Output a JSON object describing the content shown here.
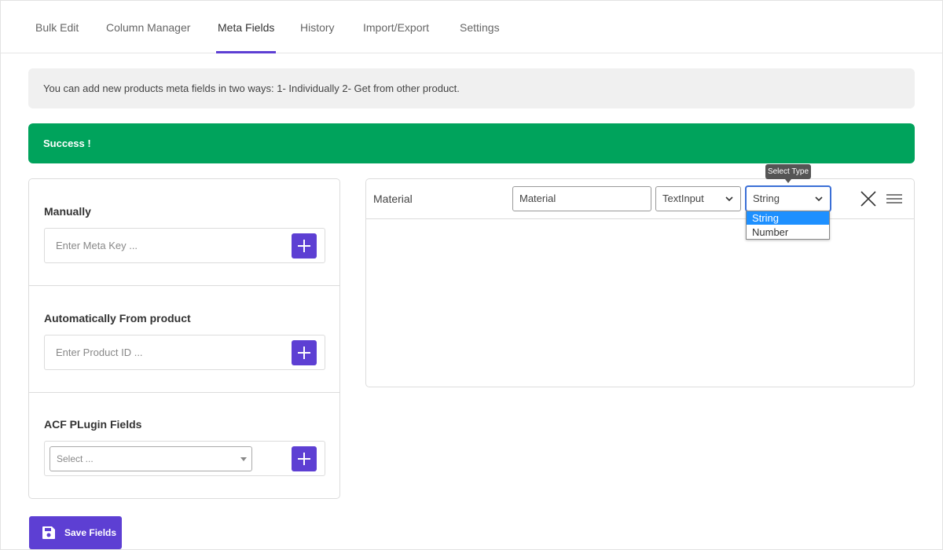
{
  "tabs": [
    {
      "label": "Bulk Edit"
    },
    {
      "label": "Column Manager"
    },
    {
      "label": "Meta Fields",
      "active": true
    },
    {
      "label": "History"
    },
    {
      "label": "Import/Export"
    },
    {
      "label": "Settings"
    }
  ],
  "notice": "You can add new products meta fields in two ways: 1- Individually 2- Get from other product.",
  "success": "Success !",
  "left": {
    "manually": {
      "title": "Manually",
      "placeholder": "Enter Meta Key ..."
    },
    "automatic": {
      "title": "Automatically From product",
      "placeholder": "Enter Product ID ..."
    },
    "acf": {
      "title": "ACF PLugin Fields",
      "select_placeholder": "Select ..."
    }
  },
  "save_label": "Save Fields",
  "meta_row": {
    "label": "Material",
    "title_value": "Material",
    "field_type": "TextInput",
    "value_type": "String",
    "value_type_options": [
      "String",
      "Number"
    ],
    "tooltip": "Select Type"
  },
  "colors": {
    "accent": "#5d3fd3",
    "success": "#00a35c",
    "highlight": "#1e90ff"
  },
  "icons": {
    "close": "close-icon",
    "menu": "hamburger-icon",
    "save": "floppy-disk-icon",
    "add": "plus-icon"
  }
}
